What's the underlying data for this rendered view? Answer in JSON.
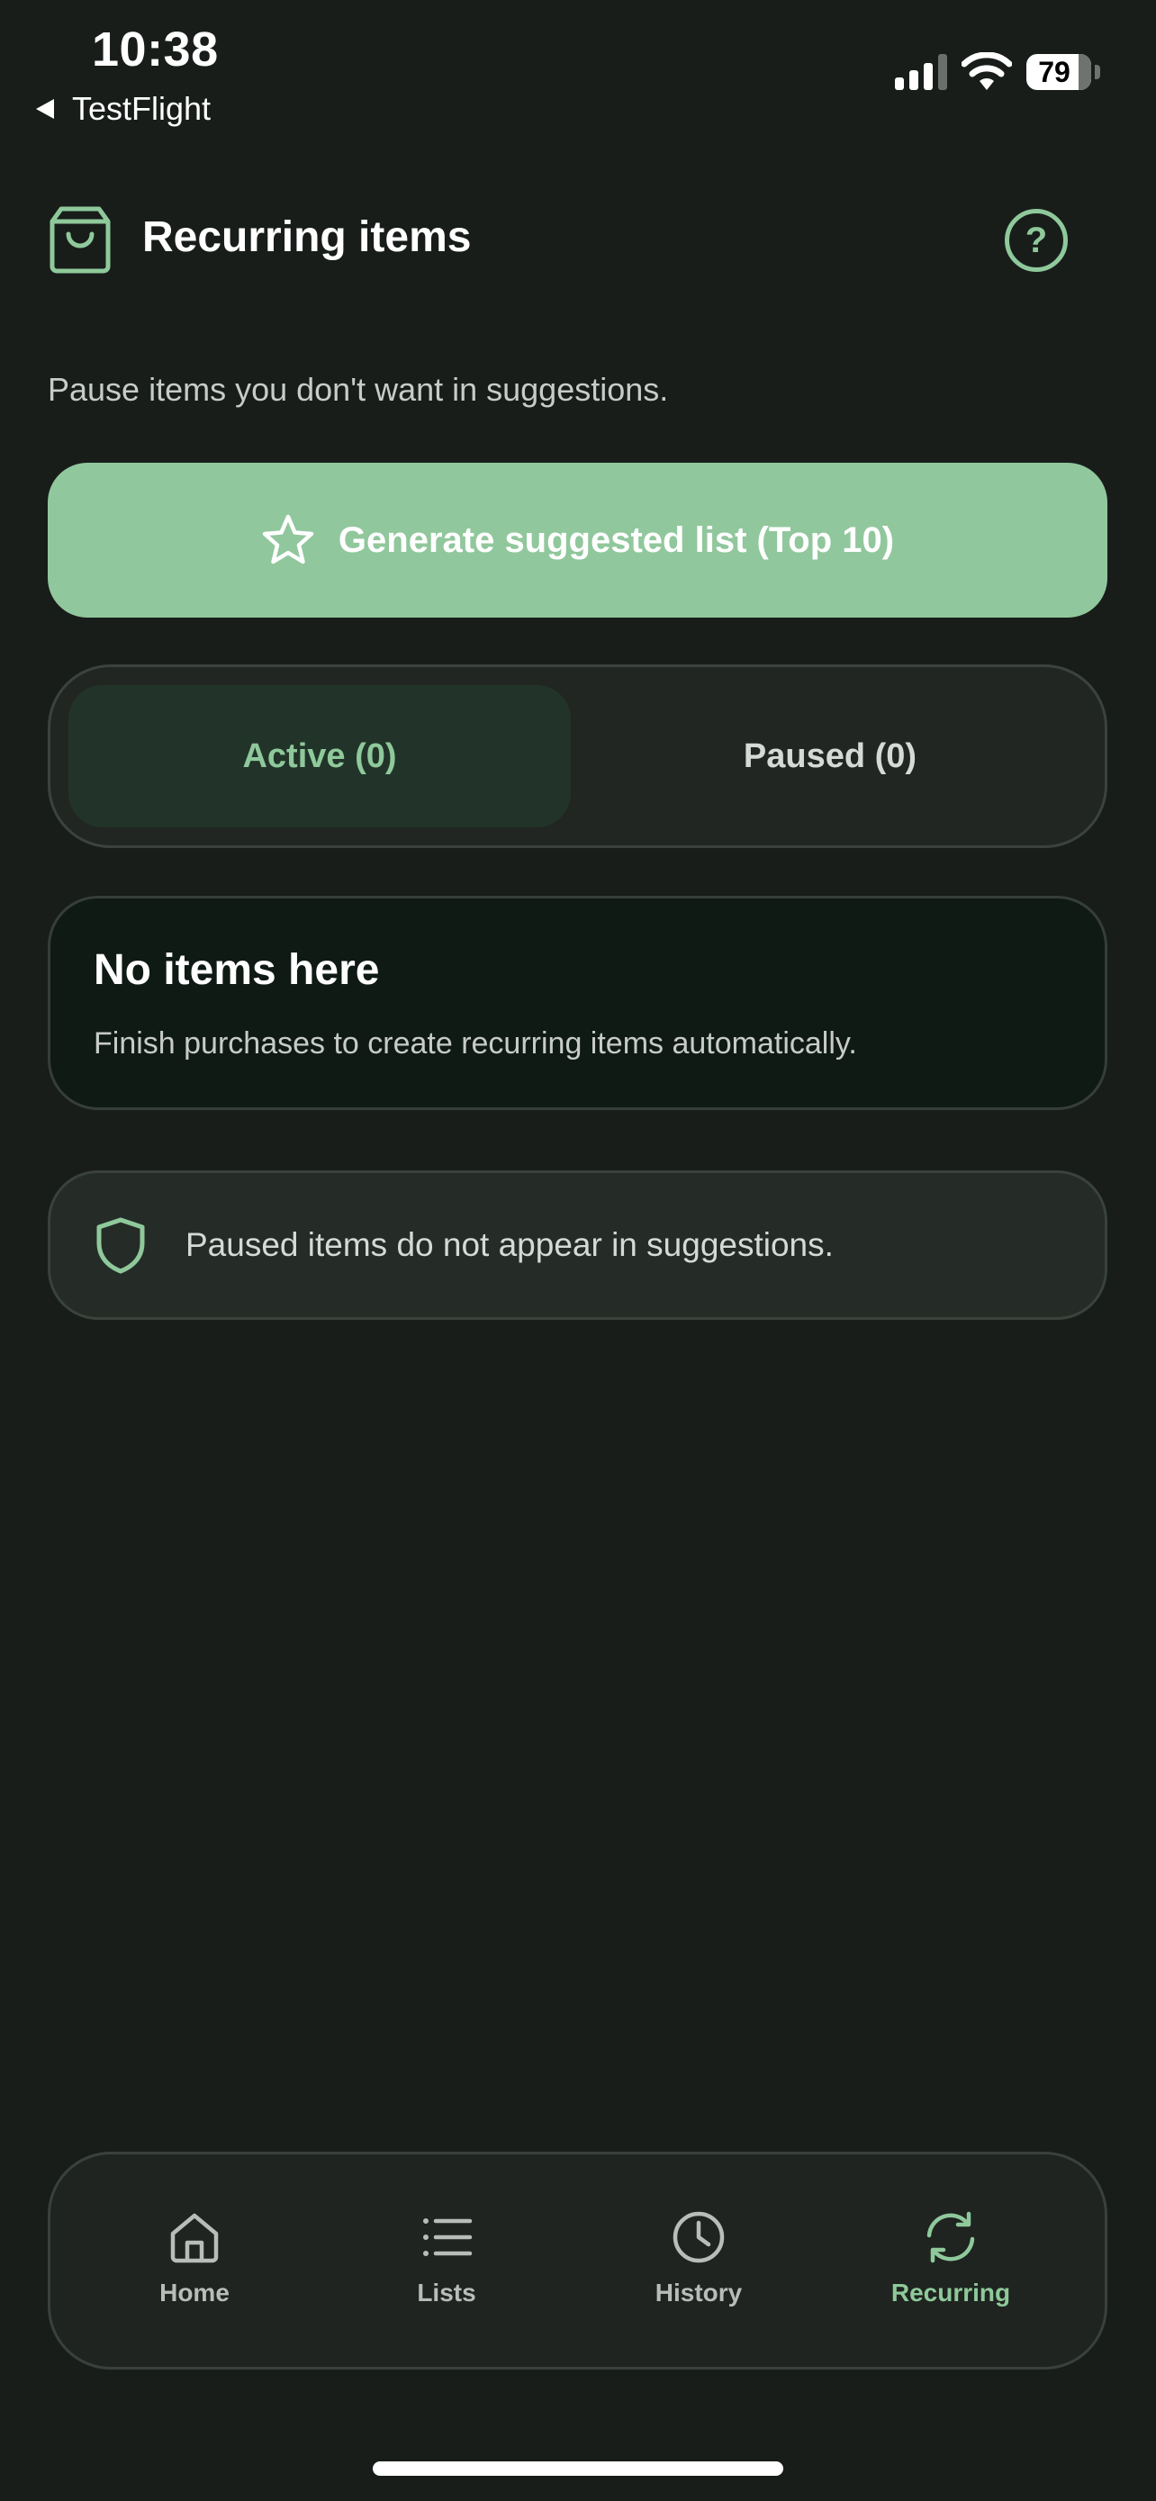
{
  "status_bar": {
    "time": "10:38",
    "back_app": "TestFlight",
    "battery_level": "79"
  },
  "header": {
    "title": "Recurring items",
    "icon": "shopping-bag-icon",
    "help_icon": "help-circle-icon",
    "help_glyph": "?"
  },
  "subtitle": "Pause items you don't want in suggestions.",
  "generate_button": {
    "label": "Generate suggested list (Top 10)",
    "icon": "star-icon"
  },
  "segmented": {
    "active_label": "Active (0)",
    "paused_label": "Paused (0)",
    "selected": "active"
  },
  "empty_state": {
    "title": "No items here",
    "description": "Finish purchases to create recurring items automatically."
  },
  "info_card": {
    "icon": "shield-icon",
    "text": "Paused items do not appear in suggestions."
  },
  "bottom_nav": {
    "items": [
      {
        "label": "Home",
        "icon": "home-icon",
        "active": false
      },
      {
        "label": "Lists",
        "icon": "list-icon",
        "active": false
      },
      {
        "label": "History",
        "icon": "clock-icon",
        "active": false
      },
      {
        "label": "Recurring",
        "icon": "refresh-icon",
        "active": true
      }
    ]
  },
  "colors": {
    "background": "#181d1a",
    "accent": "#8fc99b",
    "button_fill": "#91c79c",
    "card_dark": "#0f1a15",
    "info_card": "#252c27",
    "text_primary": "#ffffff",
    "text_secondary": "#c7ccc8"
  }
}
